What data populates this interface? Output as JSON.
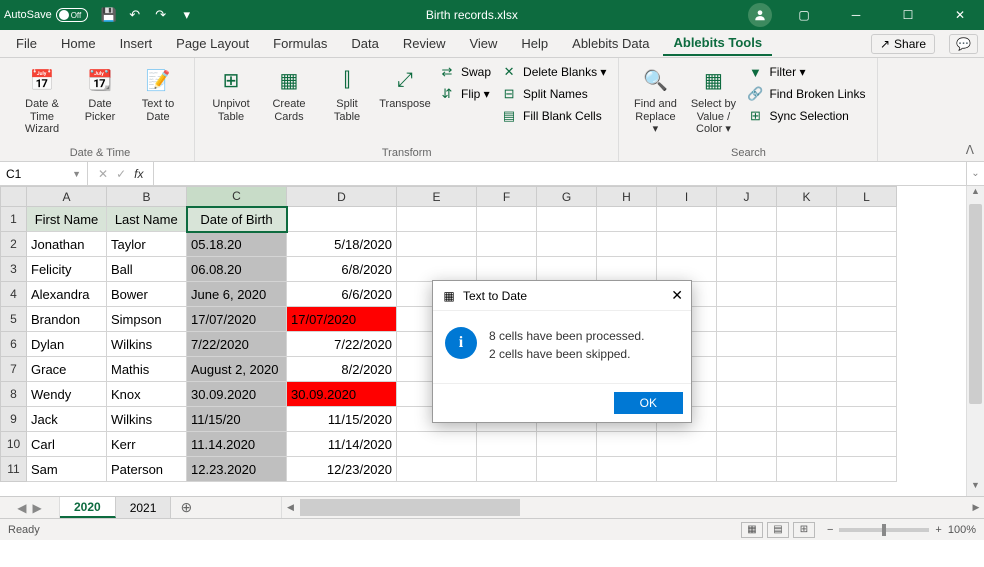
{
  "titlebar": {
    "autosave_label": "AutoSave",
    "toggle_state": "Off",
    "filename": "Birth records.xlsx"
  },
  "tabs": {
    "items": [
      "File",
      "Home",
      "Insert",
      "Page Layout",
      "Formulas",
      "Data",
      "Review",
      "View",
      "Help",
      "Ablebits Data",
      "Ablebits Tools"
    ],
    "active_index": 10,
    "share": "Share"
  },
  "ribbon": {
    "groups": [
      {
        "label": "Date & Time",
        "big": [
          {
            "icon": "📅",
            "label": "Date & Time Wizard"
          },
          {
            "icon": "📆",
            "label": "Date Picker"
          },
          {
            "icon": "📝",
            "label": "Text to Date"
          }
        ]
      },
      {
        "label": "Transform",
        "big": [
          {
            "icon": "⊞",
            "label": "Unpivot Table"
          },
          {
            "icon": "▦",
            "label": "Create Cards"
          },
          {
            "icon": "⫿",
            "label": "Split Table"
          },
          {
            "icon": "⤢",
            "label": "Transpose"
          }
        ],
        "small": [
          {
            "icon": "⇄",
            "label": "Swap"
          },
          {
            "icon": "⇵",
            "label": "Flip ▾"
          }
        ],
        "small2": [
          {
            "icon": "✕",
            "label": "Delete Blanks ▾"
          },
          {
            "icon": "⊟",
            "label": "Split Names"
          },
          {
            "icon": "▤",
            "label": "Fill Blank Cells"
          }
        ]
      },
      {
        "label": "Search",
        "big": [
          {
            "icon": "🔍",
            "label": "Find and Replace ▾"
          },
          {
            "icon": "▦",
            "label": "Select by Value / Color ▾"
          }
        ],
        "small": [
          {
            "icon": "▼",
            "label": "Filter ▾"
          },
          {
            "icon": "🔗",
            "label": "Find Broken Links"
          },
          {
            "icon": "⊞",
            "label": "Sync Selection"
          }
        ]
      }
    ]
  },
  "formula": {
    "namebox": "C1",
    "fx_label": "fx",
    "value": ""
  },
  "grid": {
    "columns": [
      "A",
      "B",
      "C",
      "D",
      "E",
      "F",
      "G",
      "H",
      "I",
      "J",
      "K",
      "L"
    ],
    "headers": [
      "First Name",
      "Last Name",
      "Date of Birth"
    ],
    "active_col_index": 2,
    "rows": [
      {
        "r": 2,
        "a": "Jonathan",
        "b": "Taylor",
        "c": "05.18.20",
        "d": "5/18/2020"
      },
      {
        "r": 3,
        "a": "Felicity",
        "b": "Ball",
        "c": "06.08.20",
        "d": "6/8/2020"
      },
      {
        "r": 4,
        "a": "Alexandra",
        "b": "Bower",
        "c": "June 6, 2020",
        "d": "6/6/2020"
      },
      {
        "r": 5,
        "a": "Brandon",
        "b": "Simpson",
        "c": "17/07/2020",
        "d": "17/07/2020",
        "d_bad": true
      },
      {
        "r": 6,
        "a": "Dylan",
        "b": "Wilkins",
        "c": "7/22/2020",
        "d": "7/22/2020"
      },
      {
        "r": 7,
        "a": "Grace",
        "b": "Mathis",
        "c": "August 2, 2020",
        "d": "8/2/2020"
      },
      {
        "r": 8,
        "a": "Wendy",
        "b": "Knox",
        "c": "30.09.2020",
        "d": "30.09.2020",
        "d_bad": true
      },
      {
        "r": 9,
        "a": "Jack",
        "b": "Wilkins",
        "c": "11/15/20",
        "d": "11/15/2020"
      },
      {
        "r": 10,
        "a": "Carl",
        "b": "Kerr",
        "c": "11.14.2020",
        "d": "11/14/2020"
      },
      {
        "r": 11,
        "a": "Sam",
        "b": "Paterson",
        "c": "12.23.2020",
        "d": "12/23/2020"
      }
    ]
  },
  "sheets": {
    "items": [
      "2020",
      "2021"
    ],
    "active_index": 0
  },
  "statusbar": {
    "status": "Ready",
    "zoom": "100%"
  },
  "dialog": {
    "title": "Text to Date",
    "line1": "8 cells have been processed.",
    "line2": "2 cells have been skipped.",
    "ok": "OK"
  }
}
